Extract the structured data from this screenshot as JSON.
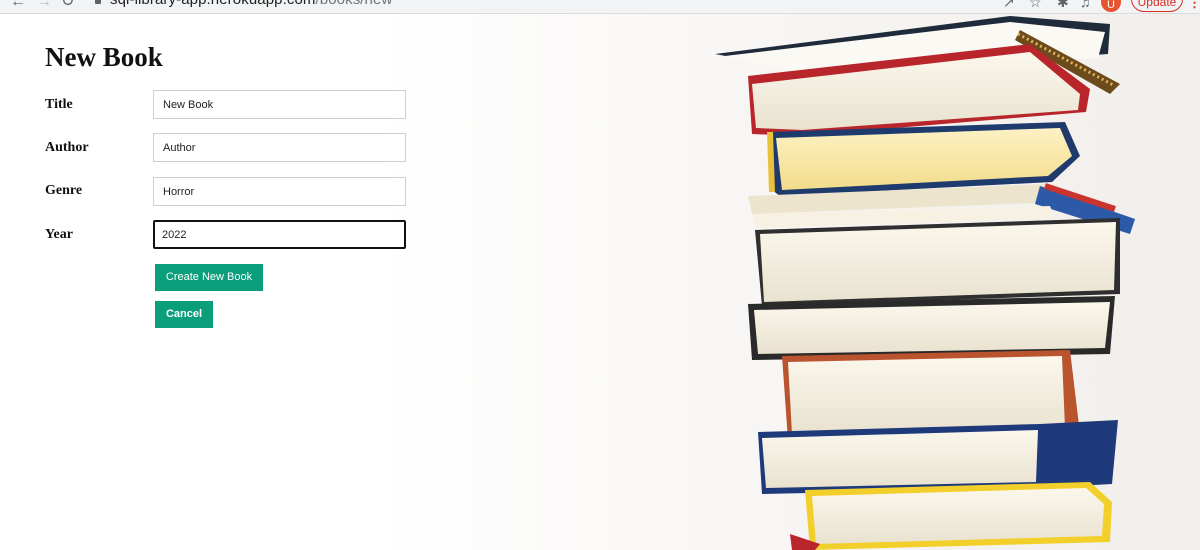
{
  "browser": {
    "back_icon": "arrow-left-icon",
    "forward_icon": "arrow-right-icon",
    "reload_icon": "reload-icon",
    "url_domain": "sql-library-app.herokuapp.com",
    "url_path": "/books/new",
    "profile_initial": "U",
    "update_label": "Update"
  },
  "form": {
    "title": "New Book",
    "fields": [
      {
        "label": "Title",
        "value": "New Book"
      },
      {
        "label": "Author",
        "value": "Author"
      },
      {
        "label": "Genre",
        "value": "Horror"
      },
      {
        "label": "Year",
        "value": "2022"
      }
    ],
    "submit_label": "Create New Book",
    "cancel_label": "Cancel"
  },
  "colors": {
    "button": "#0b9e7a",
    "update": "#d93025"
  }
}
